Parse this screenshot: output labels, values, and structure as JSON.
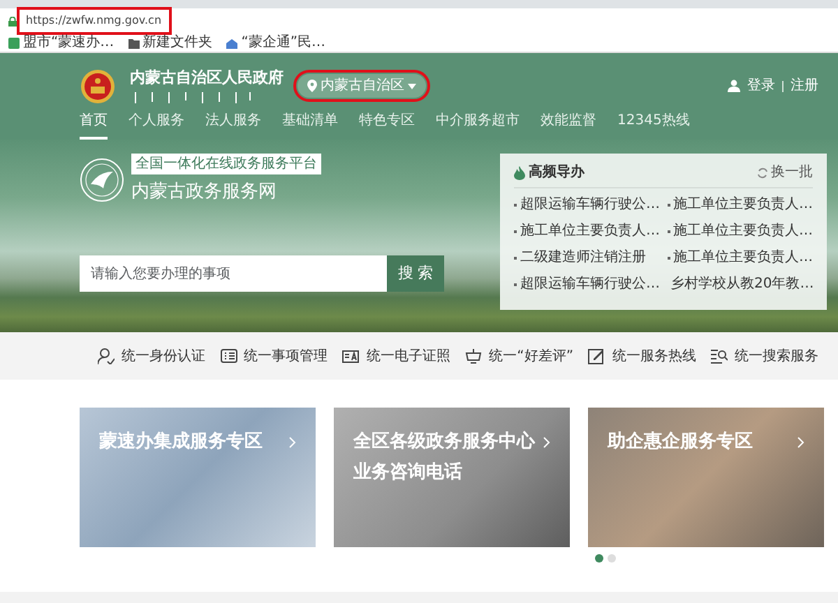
{
  "address_bar": {
    "url": "https://zwfw.nmg.gov.cn",
    "highlighted": true
  },
  "bookmarks": [
    {
      "label": "盟市“蒙速办…",
      "kind": "page"
    },
    {
      "label": "新建文件夹",
      "kind": "folder"
    },
    {
      "label": "“蒙企通”民…",
      "kind": "site"
    }
  ],
  "header": {
    "site_title": "内蒙古自治区人民政府",
    "region_selector": {
      "label": "内蒙古自治区",
      "highlighted": true
    },
    "login": "登录",
    "register": "注册"
  },
  "nav": [
    {
      "label": "首页",
      "selected": true
    },
    {
      "label": "个人服务",
      "selected": false
    },
    {
      "label": "法人服务",
      "selected": false
    },
    {
      "label": "基础清单",
      "selected": false
    },
    {
      "label": "特色专区",
      "selected": false
    },
    {
      "label": "中介服务超市",
      "selected": false
    },
    {
      "label": "效能监督",
      "selected": false
    },
    {
      "label": "12345热线",
      "selected": false
    }
  ],
  "hero": {
    "platform_badge": "全国一体化在线政务服务平台",
    "portal_name": "内蒙古政务服务网",
    "search": {
      "placeholder": "请输入您要办理的事项",
      "button": "搜 索"
    }
  },
  "hot_services": {
    "title": "高频导办",
    "refresh": "换一批",
    "items": [
      "超限运输车辆行驶公…",
      "施工单位主要负责人…",
      "施工单位主要负责人…",
      "施工单位主要负责人…",
      "二级建造师注销注册",
      "施工单位主要负责人…",
      "超限运输车辆行驶公…",
      "乡村学校从教20年教…"
    ]
  },
  "service_bar": [
    {
      "label": "统一身份认证",
      "kind": "identity"
    },
    {
      "label": "统一事项管理",
      "kind": "list"
    },
    {
      "label": "统一电子证照",
      "kind": "certificate"
    },
    {
      "label": "统一“好差评”",
      "kind": "rating"
    },
    {
      "label": "统一服务热线",
      "kind": "hotline"
    },
    {
      "label": "统一搜索服务",
      "kind": "search"
    }
  ],
  "cards": [
    {
      "title": "蒙速办集成服务专区",
      "kind": "business"
    },
    {
      "title": "全区各级政务服务中心业务咨询电话",
      "kind": "callcenter"
    },
    {
      "title": "助企惠企服务专区",
      "kind": "teamwork"
    }
  ],
  "carousel_dots": [
    {
      "selected": true
    },
    {
      "selected": false
    }
  ]
}
